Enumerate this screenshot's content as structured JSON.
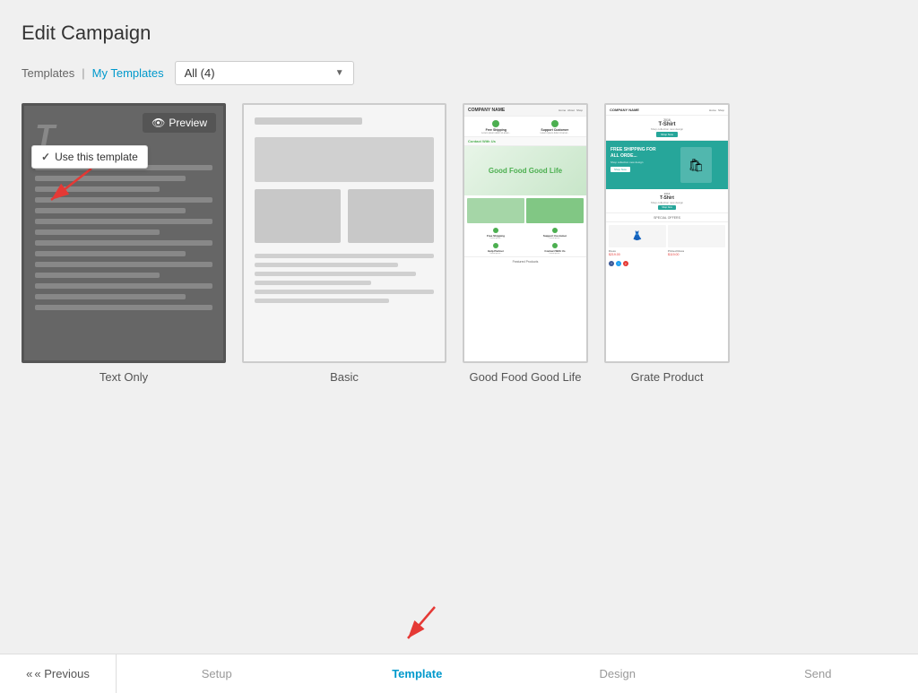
{
  "page": {
    "title": "Edit Campaign"
  },
  "filter": {
    "tab_templates": "Templates",
    "tab_my_templates": "My Templates",
    "separator": "|",
    "dropdown_label": "All (4)",
    "dropdown_arrow": "▼"
  },
  "templates": [
    {
      "id": "text-only",
      "label": "Text Only",
      "preview_label": "Preview",
      "use_label": "Use this template"
    },
    {
      "id": "basic",
      "label": "Basic"
    },
    {
      "id": "food",
      "label": "Good Food Good Life"
    },
    {
      "id": "product",
      "label": "Grate Product"
    }
  ],
  "bottom_nav": {
    "previous_label": "« Previous",
    "steps": [
      {
        "label": "Setup",
        "active": false
      },
      {
        "label": "Template",
        "active": true
      },
      {
        "label": "Design",
        "active": false
      },
      {
        "label": "Send",
        "active": false
      }
    ]
  }
}
